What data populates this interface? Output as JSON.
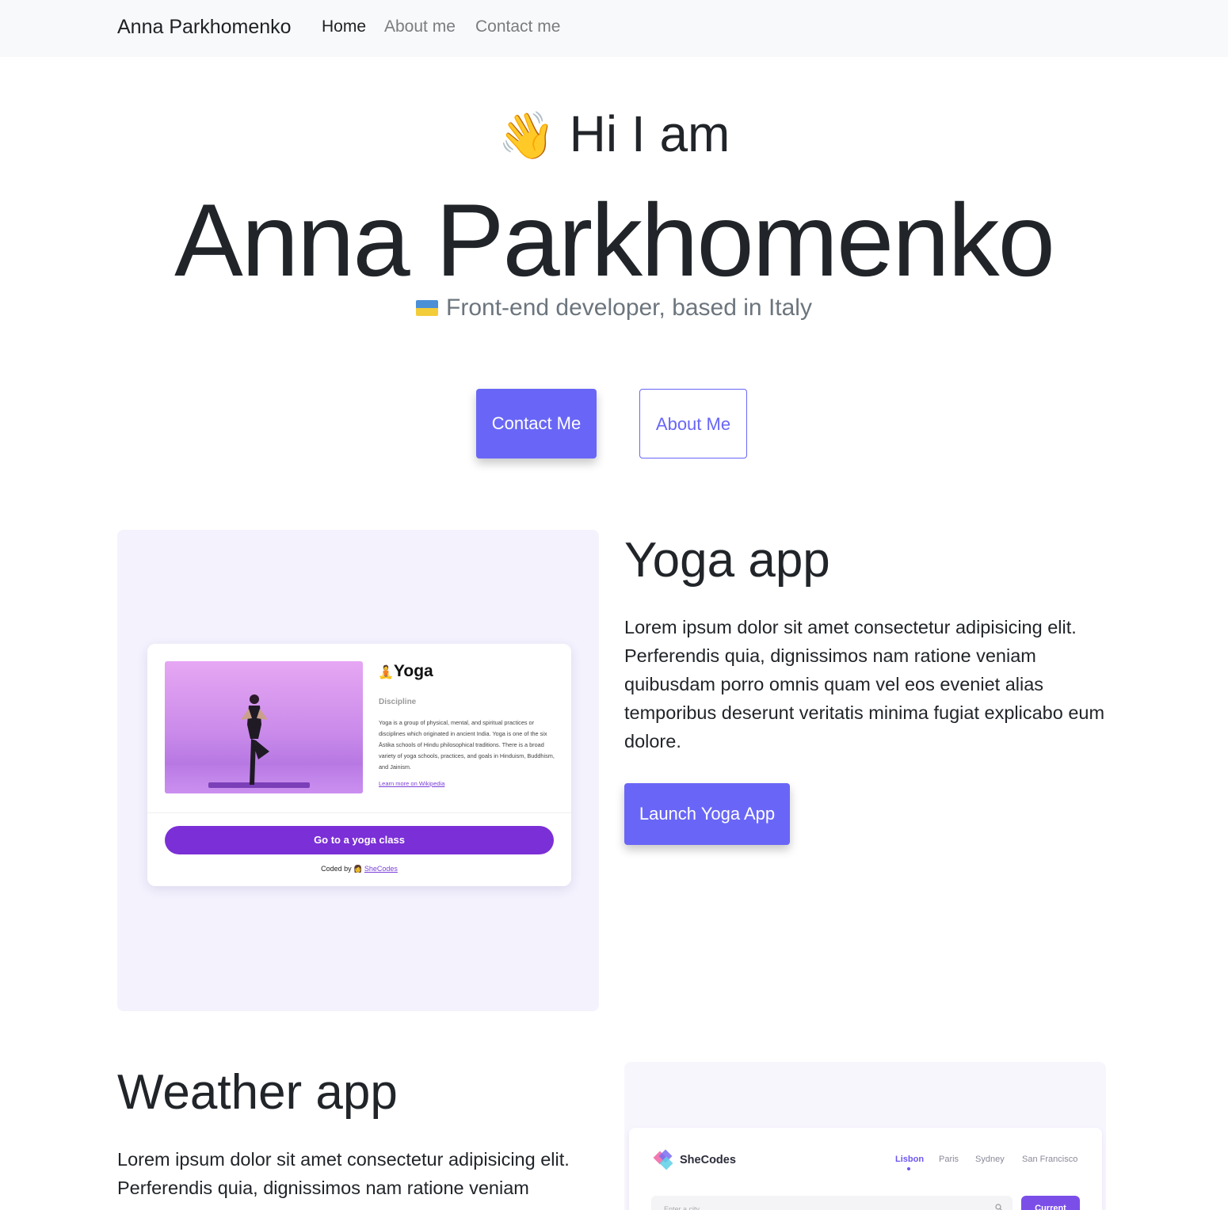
{
  "nav": {
    "brand": "Anna Parkhomenko",
    "links": [
      "Home",
      "About me",
      "Contact me"
    ],
    "active": "Home"
  },
  "hero": {
    "wave_emoji": "👋",
    "greeting": "Hi I am",
    "name": "Anna Parkhomenko",
    "subtitle": "Front-end developer, based in Italy",
    "flag_icon": "ukraine-flag-icon",
    "contact_button": "Contact Me",
    "about_button": "About Me"
  },
  "colors": {
    "accent": "#6966f7",
    "navbar_bg": "#f8f9fa",
    "text": "#212529",
    "muted": "#6c757d",
    "panel_bg": "#f4f2fd"
  },
  "yoga": {
    "heading": "Yoga app",
    "description": "Lorem ipsum dolor sit amet consectetur adipisicing elit. Perferendis quia, dignissimos nam ratione veniam quibusdam porro omnis quam vel eos eveniet alias temporibus deserunt veritatis minima fugiat explicabo eum dolore.",
    "launch_button": "Launch Yoga App",
    "preview": {
      "emoji": "🧘",
      "title": "Yoga",
      "label": "Discipline",
      "text": "Yoga is a group of physical, mental, and spiritual practices or disciplines which originated in ancient India. Yoga is one of the six Āstika schools of Hindu philosophical traditions. There is a broad variety of yoga schools, practices, and goals in Hinduism, Buddhism, and Jainism.",
      "link": "Learn more on Wikipedia",
      "cta": "Go to a yoga class",
      "coded_by": "Coded by",
      "coded_emoji": "👩",
      "shecodes": "SheCodes"
    }
  },
  "weather": {
    "heading": "Weather app",
    "description": "Lorem ipsum dolor sit amet consectetur adipisicing elit. Perferendis quia, dignissimos nam ratione veniam",
    "preview": {
      "logo_text": "SheCodes",
      "cities": [
        "Lisbon",
        "Paris",
        "Sydney",
        "San Francisco"
      ],
      "active_city": "Lisbon",
      "input_placeholder": "Enter a city",
      "current_button": "Current"
    }
  }
}
